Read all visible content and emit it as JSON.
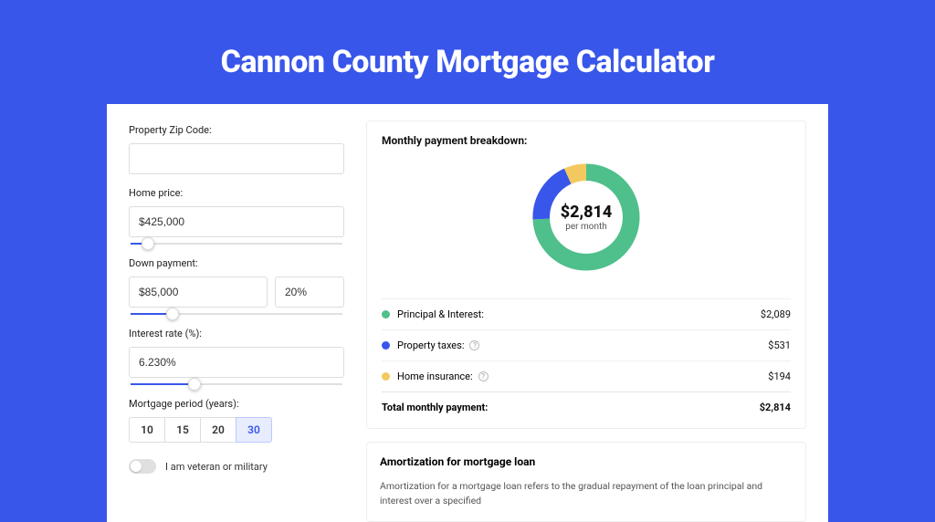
{
  "title": "Cannon County Mortgage Calculator",
  "form": {
    "zip_label": "Property Zip Code:",
    "zip_value": "",
    "home_price_label": "Home price:",
    "home_price_value": "$425,000",
    "home_price_slider_pct": 8,
    "down_label": "Down payment:",
    "down_value": "$85,000",
    "down_pct_value": "20%",
    "down_slider_pct": 20,
    "rate_label": "Interest rate (%):",
    "rate_value": "6.230%",
    "rate_slider_pct": 30,
    "period_label": "Mortgage period (years):",
    "periods": [
      "10",
      "15",
      "20",
      "30"
    ],
    "period_selected": "30",
    "veteran_label": "I am veteran or military"
  },
  "breakdown": {
    "title": "Monthly payment breakdown:",
    "total_amount": "$2,814",
    "total_sub": "per month",
    "items": [
      {
        "label": "Principal & Interest:",
        "value": "$2,089"
      },
      {
        "label": "Property taxes:",
        "value": "$531"
      },
      {
        "label": "Home insurance:",
        "value": "$194"
      }
    ],
    "total_label": "Total monthly payment:",
    "total_value": "$2,814"
  },
  "amortization": {
    "title": "Amortization for mortgage loan",
    "text": "Amortization for a mortgage loan refers to the gradual repayment of the loan principal and interest over a specified"
  },
  "chart_data": {
    "type": "pie",
    "title": "Monthly payment breakdown",
    "series": [
      {
        "name": "Principal & Interest",
        "value": 2089,
        "color": "#4fbf8b"
      },
      {
        "name": "Property taxes",
        "value": 531,
        "color": "#3956eb"
      },
      {
        "name": "Home insurance",
        "value": 194,
        "color": "#f3c95f"
      }
    ],
    "total": 2814,
    "center_label": "$2,814 per month"
  }
}
